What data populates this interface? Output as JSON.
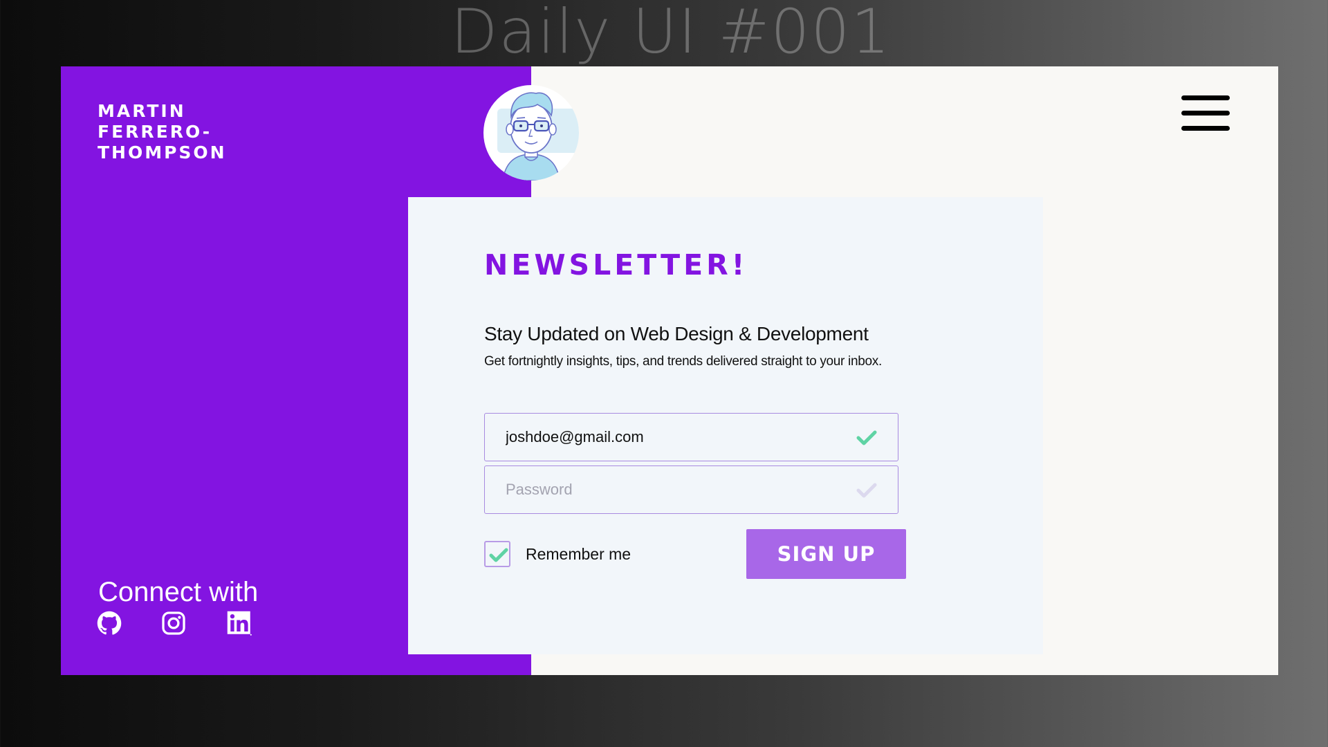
{
  "banner": {
    "title": "Daily UI #001"
  },
  "brand": {
    "name_lines": [
      "MARTIN",
      "FERRERO-",
      "THOMPSON"
    ]
  },
  "header": {
    "menu_icon": "hamburger-menu-icon",
    "avatar_icon": "developer-avatar-illustration"
  },
  "newsletter": {
    "heading": "NEWSLETTER!",
    "subtitle": "Stay Updated on Web Design & Development",
    "description": "Get fortnightly insights, tips, and trends delivered straight to your inbox.",
    "email": {
      "value": "joshdoe@gmail.com",
      "status_icon": "check-icon",
      "valid": true
    },
    "password": {
      "placeholder": "Password",
      "status_icon": "check-icon",
      "valid": false
    },
    "remember": {
      "label": "Remember me",
      "checked": true
    },
    "submit_label": "SIGN UP"
  },
  "footer": {
    "connect_label": "Connect with",
    "socials": [
      {
        "name": "GitHub",
        "icon": "github-icon"
      },
      {
        "name": "Instagram",
        "icon": "instagram-icon"
      },
      {
        "name": "LinkedIn",
        "icon": "linkedin-icon"
      }
    ]
  },
  "colors": {
    "brand_purple": "#8314e1",
    "button_purple": "#a867e8",
    "check_green": "#5fd3a4",
    "card_bg": "#f2f6fa",
    "page_bg": "#f9f8f5"
  }
}
